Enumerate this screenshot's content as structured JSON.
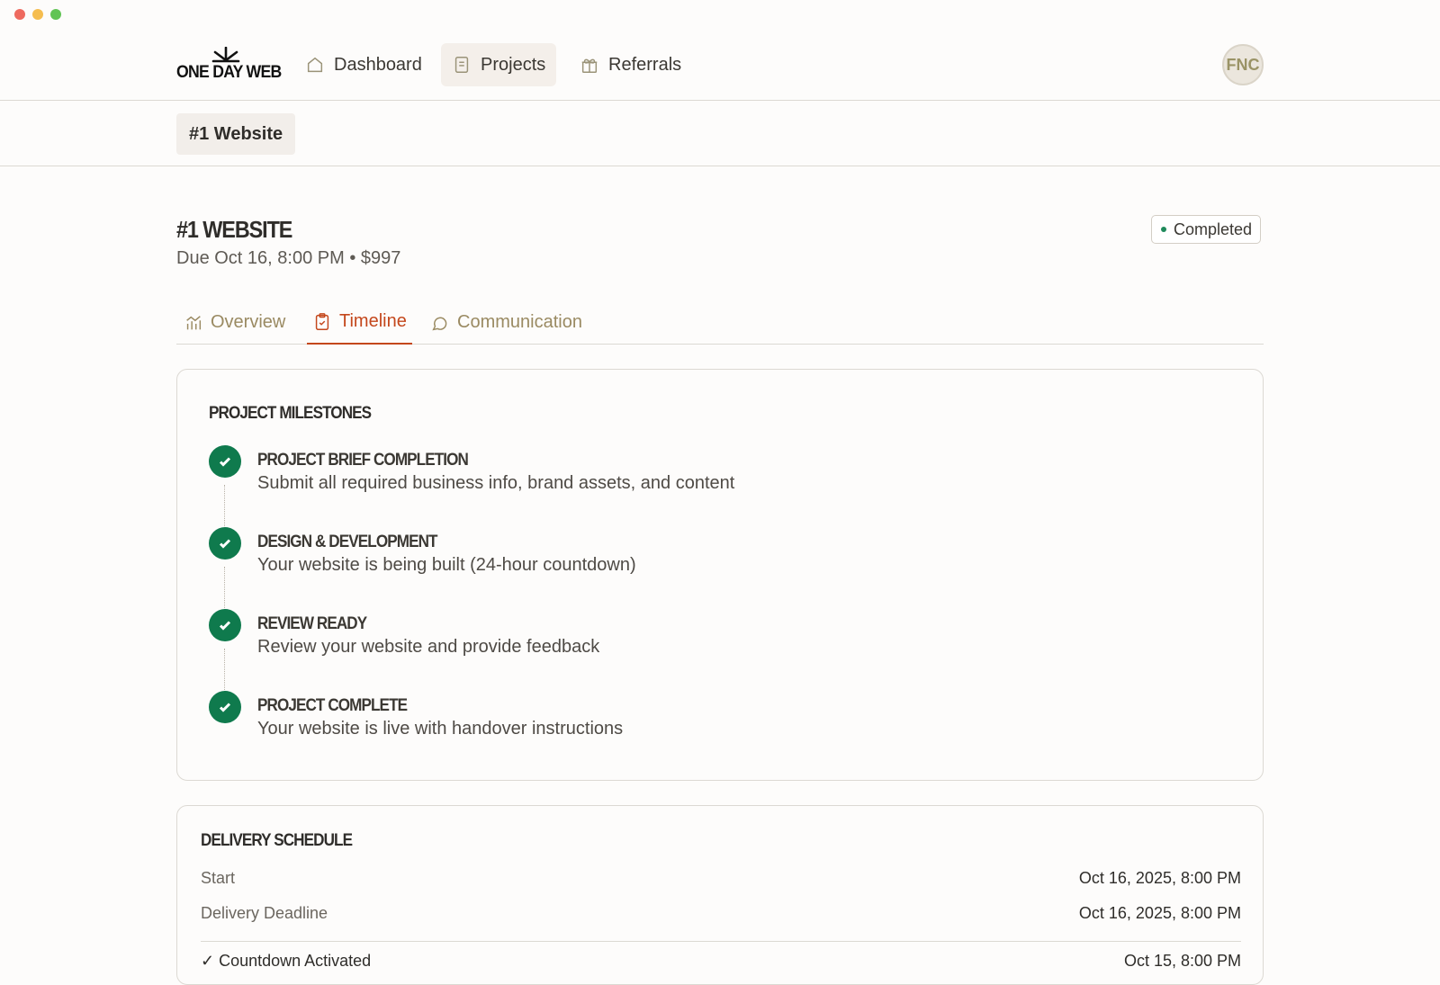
{
  "brand": {
    "logo_text": "ONE DAY WEB"
  },
  "nav": {
    "items": [
      {
        "label": "Dashboard",
        "icon": "home-icon"
      },
      {
        "label": "Projects",
        "icon": "document-icon",
        "active": true
      },
      {
        "label": "Referrals",
        "icon": "gift-icon"
      }
    ],
    "avatar_initials": "FNC"
  },
  "subnav": {
    "project_chip": "#1 Website"
  },
  "project": {
    "title": "#1 WEBSITE",
    "subtitle": "Due Oct 16, 8:00 PM • $997",
    "status": "Completed",
    "status_color": "#1f8a5b"
  },
  "tabs": [
    {
      "label": "Overview",
      "icon": "chart-icon"
    },
    {
      "label": "Timeline",
      "icon": "clipboard-check-icon",
      "active": true
    },
    {
      "label": "Communication",
      "icon": "chat-bubble-icon"
    }
  ],
  "milestones": {
    "title": "PROJECT MILESTONES",
    "items": [
      {
        "title": "PROJECT BRIEF COMPLETION",
        "desc": "Submit all required business info, brand assets, and content",
        "done": true
      },
      {
        "title": "DESIGN & DEVELOPMENT",
        "desc": "Your website is being built (24-hour countdown)",
        "done": true
      },
      {
        "title": "REVIEW READY",
        "desc": "Review your website and provide feedback",
        "done": true
      },
      {
        "title": "PROJECT COMPLETE",
        "desc": "Your website is live with handover instructions",
        "done": true
      }
    ]
  },
  "delivery": {
    "title": "DELIVERY SCHEDULE",
    "rows": [
      {
        "label": "Start",
        "value": "Oct 16, 2025, 8:00 PM"
      },
      {
        "label": "Delivery Deadline",
        "value": "Oct 16, 2025, 8:00 PM"
      }
    ],
    "partial_row": {
      "label": "✓ Countdown Activated",
      "value": "Oct 15, 8:00 PM"
    }
  },
  "colors": {
    "accent": "#c4471c",
    "success": "#0f7a4d",
    "muted_gold": "#9a8a62"
  }
}
